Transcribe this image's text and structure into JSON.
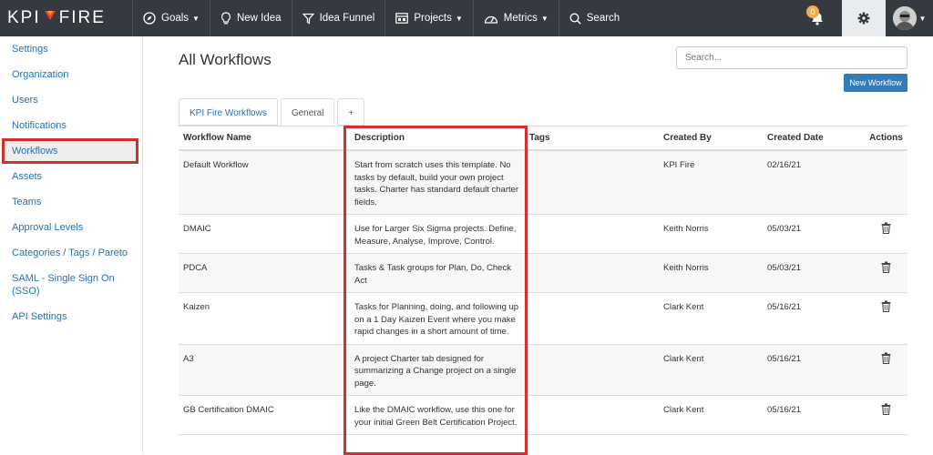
{
  "nav": {
    "logo_left": "KPI",
    "logo_right": "FIRE",
    "goals": "Goals",
    "new_idea": "New Idea",
    "idea_funnel": "Idea Funnel",
    "projects": "Projects",
    "metrics": "Metrics",
    "search": "Search",
    "notification_count": "0"
  },
  "sidebar": {
    "items": [
      {
        "label": "Settings"
      },
      {
        "label": "Organization"
      },
      {
        "label": "Users"
      },
      {
        "label": "Notifications"
      },
      {
        "label": "Workflows"
      },
      {
        "label": "Assets"
      },
      {
        "label": "Teams"
      },
      {
        "label": "Approval Levels"
      },
      {
        "label": "Categories / Tags / Pareto"
      },
      {
        "label": "SAML - Single Sign On (SSO)"
      },
      {
        "label": "API Settings"
      }
    ]
  },
  "main": {
    "title": "All Workflows",
    "search_placeholder": "Search...",
    "new_button": "New Workflow",
    "tabs": [
      {
        "label": "KPI Fire Workflows"
      },
      {
        "label": "General"
      },
      {
        "label": "+"
      }
    ],
    "columns": {
      "name": "Workflow Name",
      "description": "Description",
      "tags": "Tags",
      "created_by": "Created By",
      "created_date": "Created Date",
      "actions": "Actions"
    },
    "rows": [
      {
        "name": "Default Workflow",
        "description": "Start from scratch uses this template. No tasks by default, build your own project tasks. Charter has standard default charter fields.",
        "created_by": "KPI Fire",
        "created_date": "02/16/21"
      },
      {
        "name": "DMAIC",
        "description": "Use for Larger Six Sigma projects. Define, Measure, Analyse, Improve, Control.",
        "created_by": "Keith Norris",
        "created_date": "05/03/21"
      },
      {
        "name": "PDCA",
        "description": "Tasks & Task groups for Plan, Do, Check Act",
        "created_by": "Keith Norris",
        "created_date": "05/03/21"
      },
      {
        "name": "Kaizen",
        "description": "Tasks for Planning, doing, and following up on a 1 Day Kaizen Event where you make rapid changes in a short amount of time.",
        "created_by": "Clark Kent",
        "created_date": "05/16/21"
      },
      {
        "name": "A3",
        "description": "A project Charter tab designed for summarizing a Change project on a single page.",
        "created_by": "Clark Kent",
        "created_date": "05/16/21"
      },
      {
        "name": "GB Certification DMAIC",
        "description": "Like the DMAIC workflow, use this one for your initial Green Belt Certification Project.",
        "created_by": "Clark Kent",
        "created_date": "05/16/21"
      }
    ]
  },
  "colors": {
    "topbar": "#343a40",
    "link": "#2a6fb6",
    "primary_button": "#337ab7",
    "highlight": "#d0312d",
    "badge": "#f0ad4e"
  }
}
